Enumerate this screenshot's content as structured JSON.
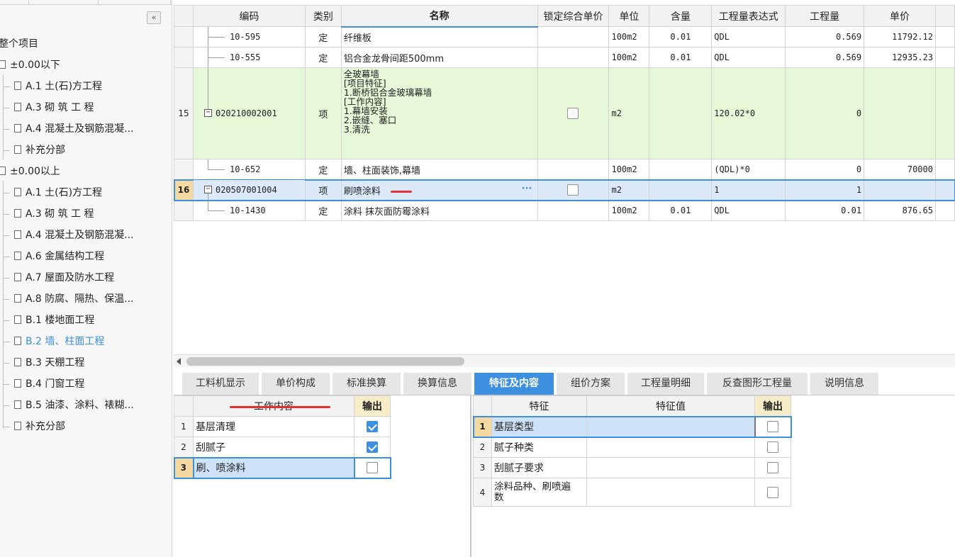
{
  "tree": {
    "root": "整个项目",
    "nodes": [
      {
        "label": "±0.00以下",
        "level": 0
      },
      {
        "label": "A.1  土(石)方工程",
        "level": 1
      },
      {
        "label": "A.3  砌 筑 工 程",
        "level": 1
      },
      {
        "label": "A.4  混凝土及钢筋混凝...",
        "level": 1
      },
      {
        "label": "补充分部",
        "level": 1
      },
      {
        "label": "±0.00以上",
        "level": 0
      },
      {
        "label": "A.1  土(石)方工程",
        "level": 1
      },
      {
        "label": "A.3  砌 筑 工 程",
        "level": 1
      },
      {
        "label": "A.4  混凝土及钢筋混凝...",
        "level": 1
      },
      {
        "label": "A.6  金属结构工程",
        "level": 1
      },
      {
        "label": "A.7  屋面及防水工程",
        "level": 1
      },
      {
        "label": "A.8  防腐、隔热、保温...",
        "level": 1
      },
      {
        "label": "B.1  楼地面工程",
        "level": 1
      },
      {
        "label": "B.2  墙、柱面工程",
        "level": 1,
        "selected": true
      },
      {
        "label": "B.3  天棚工程",
        "level": 1
      },
      {
        "label": "B.4  门窗工程",
        "level": 1
      },
      {
        "label": "B.5  油漆、涂料、裱糊...",
        "level": 1
      },
      {
        "label": "补充分部",
        "level": 1
      }
    ],
    "collapse_icon": "«"
  },
  "grid": {
    "headers": [
      "编码",
      "类别",
      "名称",
      "锁定综合单价",
      "单位",
      "含量",
      "工程量表达式",
      "工程量",
      "单价"
    ],
    "rows": [
      {
        "num": "",
        "code": "10-595",
        "type": "定",
        "name": "纤维板",
        "lock": null,
        "unit": "100m2",
        "content": "0.01",
        "expr": "QDL",
        "qty": "0.569",
        "price": "11792.12"
      },
      {
        "num": "",
        "code": "10-555",
        "type": "定",
        "name": "铝合金龙骨间距500mm",
        "lock": null,
        "unit": "100m2",
        "content": "0.01",
        "expr": "QDL",
        "qty": "0.569",
        "price": "12935.23"
      },
      {
        "num": "15",
        "code": "020210002001",
        "type": "项",
        "name_lines": [
          "全玻幕墙",
          "[项目特征]",
          "1.断桥铝合金玻璃幕墙",
          "[工作内容]",
          "1.幕墙安装",
          "2.嵌缝、塞口",
          "3.清洗"
        ],
        "lock": false,
        "unit": "m2",
        "content": "",
        "expr": "120.02*0",
        "qty": "0",
        "price": ""
      },
      {
        "num": "",
        "code": "10-652",
        "type": "定",
        "name": "墙、柱面装饰,幕墙",
        "lock": null,
        "unit": "100m2",
        "content": "",
        "expr": "(QDL)*0",
        "qty": "0",
        "price": "70000"
      },
      {
        "num": "16",
        "code": "020507001004",
        "type": "项",
        "name": "刷喷涂料",
        "name_button": "···",
        "lock": false,
        "unit": "m2",
        "content": "",
        "expr": "1",
        "qty": "1",
        "price": ""
      },
      {
        "num": "",
        "code": "10-1430",
        "type": "定",
        "name": "涂料 抹灰面防霉涂料",
        "lock": null,
        "unit": "100m2",
        "content": "0.01",
        "expr": "QDL",
        "qty": "0.01",
        "price": "876.65"
      }
    ]
  },
  "tabs": [
    {
      "label": "工料机显示"
    },
    {
      "label": "单价构成"
    },
    {
      "label": "标准换算"
    },
    {
      "label": "换算信息"
    },
    {
      "label": "特征及内容",
      "active": true
    },
    {
      "label": "组价方案"
    },
    {
      "label": "工程量明细"
    },
    {
      "label": "反查图形工程量"
    },
    {
      "label": "说明信息"
    }
  ],
  "work_content": {
    "headers": [
      "工作内容",
      "输出"
    ],
    "rows": [
      {
        "num": "1",
        "label": "基层清理",
        "output": true
      },
      {
        "num": "2",
        "label": "刮腻子",
        "output": true
      },
      {
        "num": "3",
        "label": "刷、喷涂料",
        "output": false
      }
    ]
  },
  "features": {
    "headers": [
      "特征",
      "特征值",
      "输出"
    ],
    "rows": [
      {
        "num": "1",
        "label": "基层类型",
        "value": "",
        "output": false
      },
      {
        "num": "2",
        "label": "腻子种类",
        "value": "",
        "output": false
      },
      {
        "num": "3",
        "label": "刮腻子要求",
        "value": "",
        "output": false
      },
      {
        "num": "4",
        "label_lines": [
          "涂料品种、刷喷遍",
          "数"
        ],
        "value": "",
        "output": false
      }
    ]
  }
}
